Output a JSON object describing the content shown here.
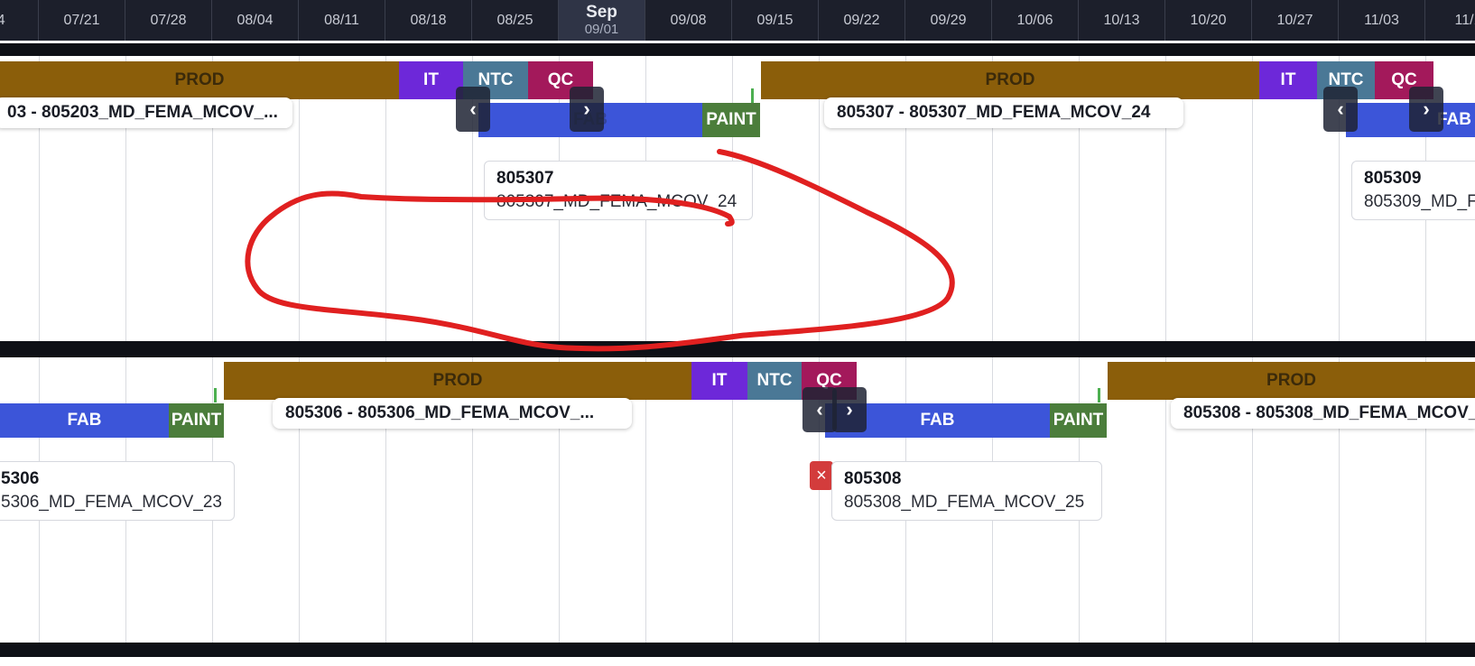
{
  "timeline": {
    "dates": [
      "/14",
      "07/21",
      "07/28",
      "08/04",
      "08/11",
      "08/18",
      "08/25",
      "SEL",
      "09/08",
      "09/15",
      "09/22",
      "09/29",
      "10/06",
      "10/13",
      "10/20",
      "10/27",
      "11/03",
      "11/1"
    ],
    "selected": {
      "month": "Sep",
      "day": "09/01"
    }
  },
  "row1": {
    "prod_a": "PROD",
    "it_a": "IT",
    "ntc_a": "NTC",
    "qc_a": "QC",
    "label_a": "03 - 805203_MD_FEMA_MCOV_...",
    "fab_a": "FAB",
    "paint_a": "PAINT",
    "card_a": {
      "id": "805307",
      "name": "805307_MD_FEMA_MCOV_24"
    },
    "prod_b": "PROD",
    "it_b": "IT",
    "ntc_b": "NTC",
    "qc_b": "QC",
    "label_b": "805307 - 805307_MD_FEMA_MCOV_24",
    "fab_b": "FAB",
    "card_b": {
      "id": "805309",
      "name": "805309_MD_F"
    }
  },
  "row2": {
    "fab_a": "FAB",
    "paint_a": "PAINT",
    "card_a": {
      "id": "5306",
      "name": "5306_MD_FEMA_MCOV_23"
    },
    "prod_a": "PROD",
    "it_a": "IT",
    "ntc_a": "NTC",
    "qc_a": "QC",
    "label_a": "805306 - 805306_MD_FEMA_MCOV_...",
    "fab_b": "FAB",
    "paint_b": "PAINT",
    "card_b": {
      "id": "805308",
      "name": "805308_MD_FEMA_MCOV_25"
    },
    "prod_b": "PROD",
    "label_b": "805308 - 805308_MD_FEMA_MCOV_25"
  },
  "icons": {
    "prev": "‹",
    "next": "›",
    "close": "×"
  },
  "colors": {
    "header_bg": "#1c1f2b",
    "prod": "#8b5e0a",
    "it": "#6d28d9",
    "ntc": "#4a7896",
    "qc": "#a3195b",
    "fab": "#3c55d9",
    "paint": "#4b7d3b",
    "annotation": "#e02020"
  }
}
